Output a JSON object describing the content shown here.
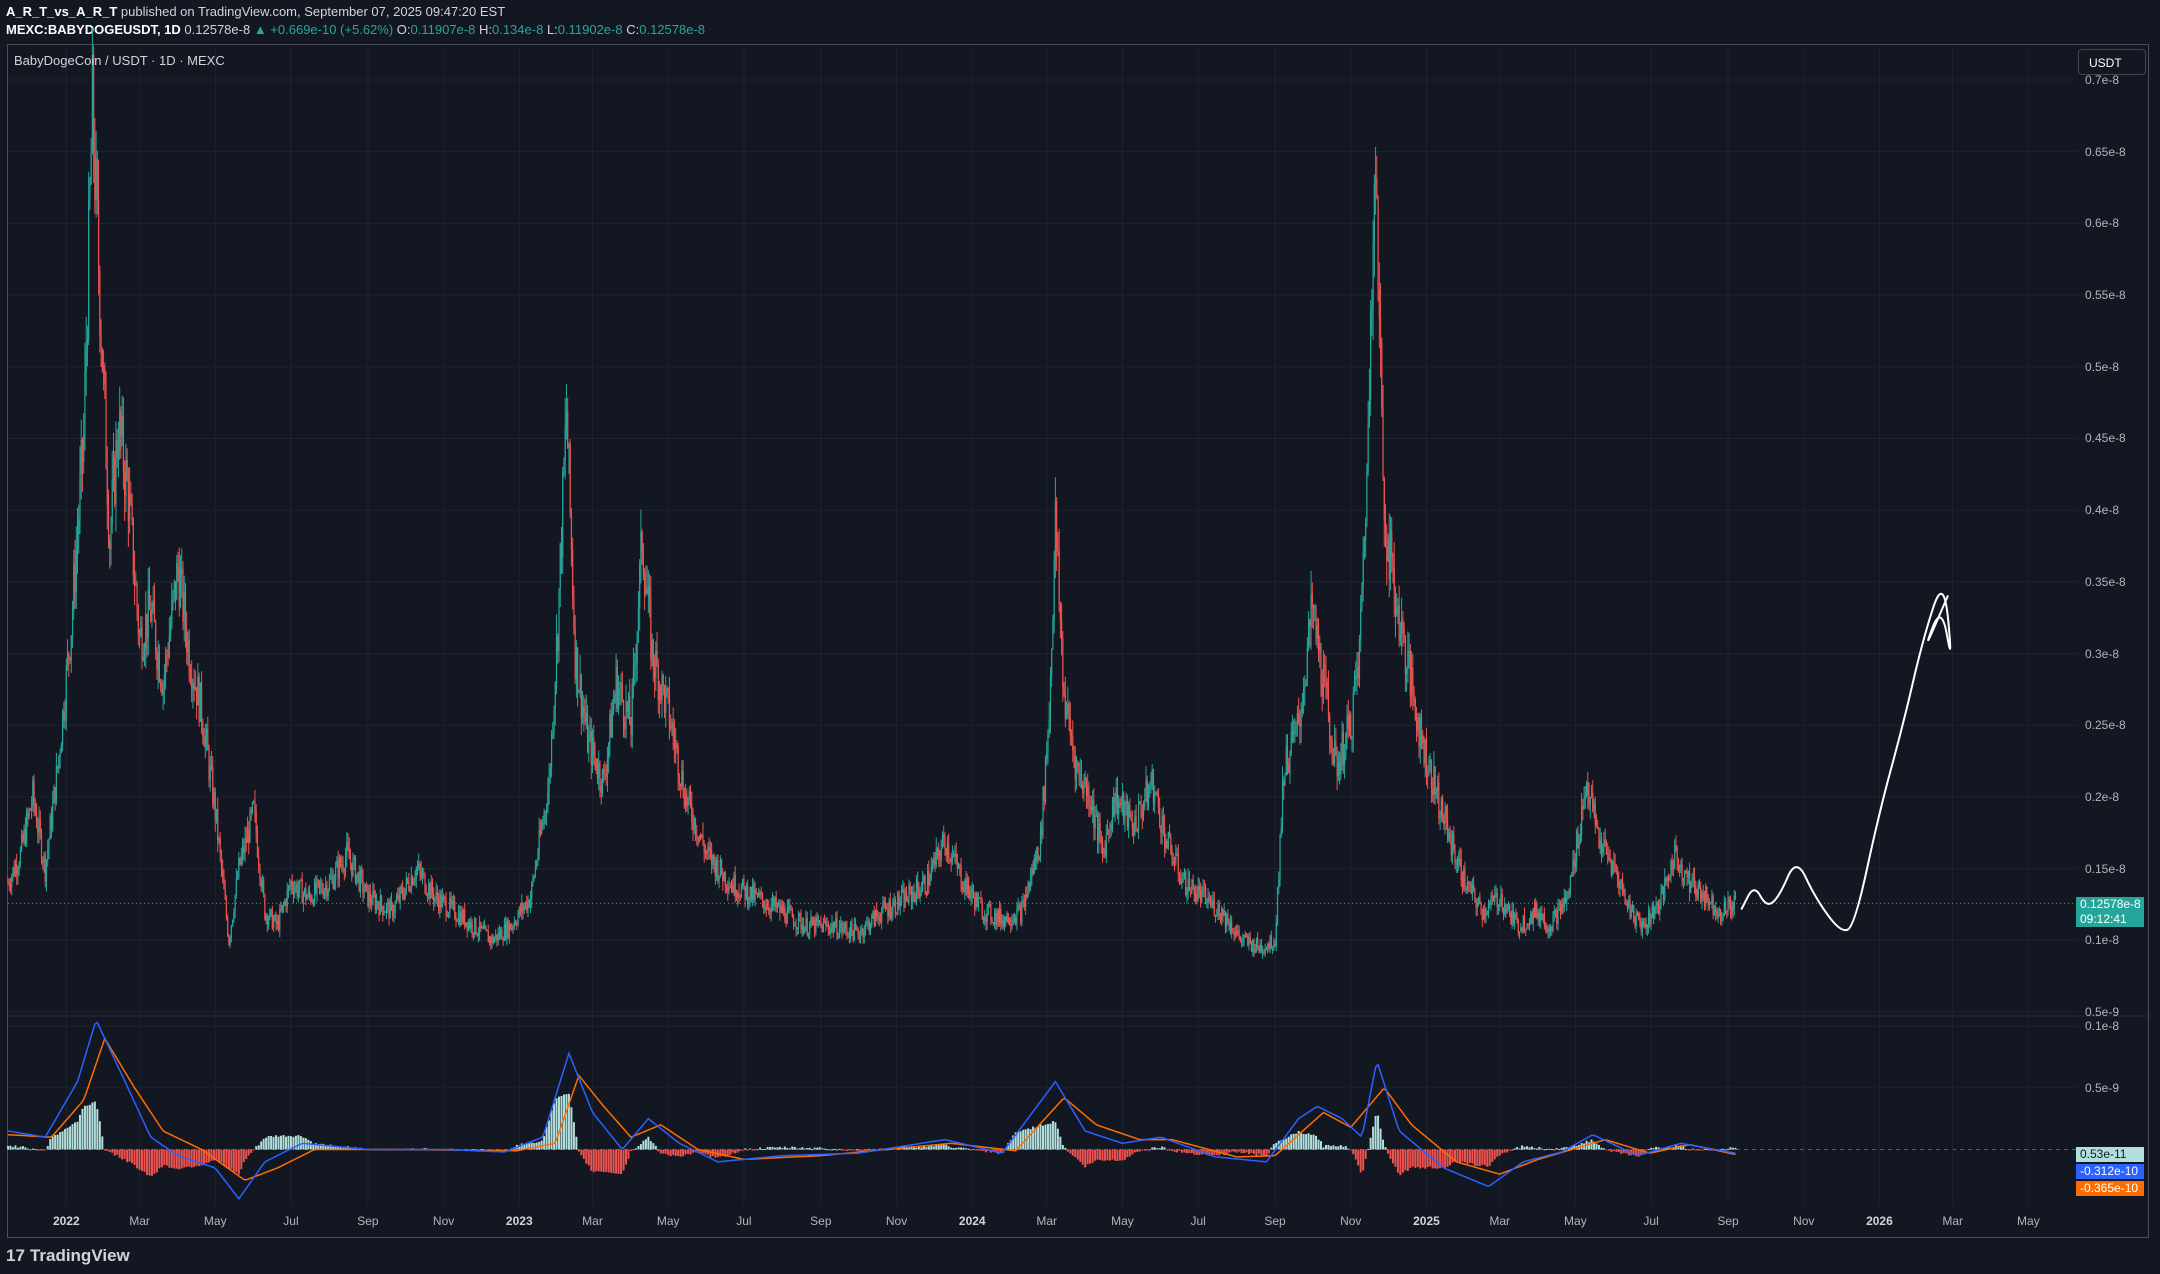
{
  "header": {
    "author": "A_R_T_vs_A_R_T",
    "published": "published on TradingView.com, September 07, 2025 09:47:20 EST",
    "symbol": "MEXC:BABYDOGEUSDT, 1D",
    "last": "0.12578e-8",
    "change": "▲ +0.669e-10 (+5.62%)",
    "o_label": "O:",
    "o_value": "0.11907e-8",
    "h_label": "H:",
    "h_value": "0.134e-8",
    "l_label": "L:",
    "l_value": "0.11902e-8",
    "c_label": "C:",
    "c_value": "0.12578e-8"
  },
  "legend": "BabyDogeCoin / USDT · 1D · MEXC",
  "currency_button": "USDT",
  "price_tag": {
    "price": "0.12578e-8",
    "countdown": "09:12:41"
  },
  "indicator_tags": {
    "histogram": "0.53e-11",
    "macd": "-0.312e-10",
    "signal": "-0.365e-10"
  },
  "footer": {
    "brand": "TradingView",
    "logo_mark": "17"
  },
  "colors": {
    "background": "#131722",
    "up": "#26a69a",
    "down": "#ef5350",
    "macd": "#2962ff",
    "signal": "#ff6d00",
    "hist_pos": "#b2dfdb",
    "drawing": "#ffffff"
  },
  "chart_data": {
    "type": "candlestick",
    "title": "BabyDogeCoin / USDT · 1D · MEXC",
    "ylabel": "USDT",
    "y_tick_labels": [
      "0.7e-8",
      "0.65e-8",
      "0.6e-8",
      "0.55e-8",
      "0.5e-8",
      "0.45e-8",
      "0.4e-8",
      "0.35e-8",
      "0.3e-8",
      "0.25e-8",
      "0.2e-8",
      "0.15e-8",
      "0.1e-8",
      "0.5e-9"
    ],
    "y_ticks": [
      0.7,
      0.65,
      0.6,
      0.55,
      0.5,
      0.45,
      0.4,
      0.35,
      0.3,
      0.25,
      0.2,
      0.15,
      0.1,
      0.05
    ],
    "y_unit_note": "values in units of 1e-8 USDT",
    "ylim": [
      0.05,
      0.7
    ],
    "x_tick_labels": [
      {
        "label": "2022",
        "date": "2022-01-01",
        "year": true
      },
      {
        "label": "Mar",
        "date": "2022-03-01"
      },
      {
        "label": "May",
        "date": "2022-05-01"
      },
      {
        "label": "Jul",
        "date": "2022-07-01"
      },
      {
        "label": "Sep",
        "date": "2022-09-01"
      },
      {
        "label": "Nov",
        "date": "2022-11-01"
      },
      {
        "label": "2023",
        "date": "2023-01-01",
        "year": true
      },
      {
        "label": "Mar",
        "date": "2023-03-01"
      },
      {
        "label": "May",
        "date": "2023-05-01"
      },
      {
        "label": "Jul",
        "date": "2023-07-01"
      },
      {
        "label": "Sep",
        "date": "2023-09-01"
      },
      {
        "label": "Nov",
        "date": "2023-11-01"
      },
      {
        "label": "2024",
        "date": "2024-01-01",
        "year": true
      },
      {
        "label": "Mar",
        "date": "2024-03-01"
      },
      {
        "label": "May",
        "date": "2024-05-01"
      },
      {
        "label": "Jul",
        "date": "2024-07-01"
      },
      {
        "label": "Sep",
        "date": "2024-09-01"
      },
      {
        "label": "Nov",
        "date": "2024-11-01"
      },
      {
        "label": "2025",
        "date": "2025-01-01",
        "year": true
      },
      {
        "label": "Mar",
        "date": "2025-03-01"
      },
      {
        "label": "May",
        "date": "2025-05-01"
      },
      {
        "label": "Jul",
        "date": "2025-07-01"
      },
      {
        "label": "Sep",
        "date": "2025-09-01"
      },
      {
        "label": "Nov",
        "date": "2025-11-01"
      },
      {
        "label": "2026",
        "date": "2026-01-01",
        "year": true
      },
      {
        "label": "Mar",
        "date": "2026-03-01"
      },
      {
        "label": "May",
        "date": "2026-05-01"
      }
    ],
    "x_range": [
      "2021-11-15",
      "2026-06-10"
    ],
    "price_path": [
      [
        "2021-11-15",
        0.14
      ],
      [
        "2021-11-25",
        0.16
      ],
      [
        "2021-12-05",
        0.2
      ],
      [
        "2021-12-15",
        0.15
      ],
      [
        "2021-12-25",
        0.22
      ],
      [
        "2022-01-05",
        0.32
      ],
      [
        "2022-01-15",
        0.45
      ],
      [
        "2022-01-22",
        0.68
      ],
      [
        "2022-01-28",
        0.55
      ],
      [
        "2022-02-05",
        0.38
      ],
      [
        "2022-02-12",
        0.46
      ],
      [
        "2022-02-20",
        0.41
      ],
      [
        "2022-03-01",
        0.31
      ],
      [
        "2022-03-10",
        0.33
      ],
      [
        "2022-03-20",
        0.28
      ],
      [
        "2022-04-01",
        0.36
      ],
      [
        "2022-04-10",
        0.3
      ],
      [
        "2022-04-20",
        0.26
      ],
      [
        "2022-05-01",
        0.19
      ],
      [
        "2022-05-12",
        0.1
      ],
      [
        "2022-05-20",
        0.15
      ],
      [
        "2022-06-01",
        0.19
      ],
      [
        "2022-06-10",
        0.12
      ],
      [
        "2022-06-20",
        0.11
      ],
      [
        "2022-07-01",
        0.14
      ],
      [
        "2022-07-15",
        0.13
      ],
      [
        "2022-08-01",
        0.14
      ],
      [
        "2022-08-15",
        0.16
      ],
      [
        "2022-09-01",
        0.13
      ],
      [
        "2022-09-20",
        0.12
      ],
      [
        "2022-10-10",
        0.15
      ],
      [
        "2022-10-25",
        0.13
      ],
      [
        "2022-11-10",
        0.12
      ],
      [
        "2022-11-25",
        0.11
      ],
      [
        "2022-12-10",
        0.1
      ],
      [
        "2022-12-25",
        0.11
      ],
      [
        "2023-01-10",
        0.13
      ],
      [
        "2023-01-25",
        0.21
      ],
      [
        "2023-02-01",
        0.32
      ],
      [
        "2023-02-08",
        0.47
      ],
      [
        "2023-02-15",
        0.3
      ],
      [
        "2023-02-25",
        0.24
      ],
      [
        "2023-03-10",
        0.21
      ],
      [
        "2023-03-20",
        0.28
      ],
      [
        "2023-04-01",
        0.25
      ],
      [
        "2023-04-10",
        0.38
      ],
      [
        "2023-04-18",
        0.3
      ],
      [
        "2023-05-01",
        0.26
      ],
      [
        "2023-05-15",
        0.2
      ],
      [
        "2023-06-01",
        0.16
      ],
      [
        "2023-06-20",
        0.14
      ],
      [
        "2023-07-10",
        0.13
      ],
      [
        "2023-08-01",
        0.12
      ],
      [
        "2023-08-20",
        0.11
      ],
      [
        "2023-09-10",
        0.11
      ],
      [
        "2023-10-01",
        0.105
      ],
      [
        "2023-10-20",
        0.12
      ],
      [
        "2023-11-10",
        0.13
      ],
      [
        "2023-11-25",
        0.14
      ],
      [
        "2023-12-10",
        0.17
      ],
      [
        "2023-12-25",
        0.14
      ],
      [
        "2024-01-10",
        0.12
      ],
      [
        "2024-01-25",
        0.115
      ],
      [
        "2024-02-10",
        0.12
      ],
      [
        "2024-02-25",
        0.17
      ],
      [
        "2024-03-03",
        0.26
      ],
      [
        "2024-03-08",
        0.39
      ],
      [
        "2024-03-15",
        0.27
      ],
      [
        "2024-03-25",
        0.22
      ],
      [
        "2024-04-05",
        0.2
      ],
      [
        "2024-04-15",
        0.16
      ],
      [
        "2024-04-25",
        0.2
      ],
      [
        "2024-05-10",
        0.18
      ],
      [
        "2024-05-25",
        0.21
      ],
      [
        "2024-06-05",
        0.17
      ],
      [
        "2024-06-20",
        0.14
      ],
      [
        "2024-07-05",
        0.13
      ],
      [
        "2024-07-20",
        0.12
      ],
      [
        "2024-08-05",
        0.1
      ],
      [
        "2024-08-20",
        0.095
      ],
      [
        "2024-09-01",
        0.1
      ],
      [
        "2024-09-08",
        0.22
      ],
      [
        "2024-09-20",
        0.25
      ],
      [
        "2024-10-01",
        0.33
      ],
      [
        "2024-10-10",
        0.28
      ],
      [
        "2024-10-20",
        0.22
      ],
      [
        "2024-11-01",
        0.25
      ],
      [
        "2024-11-08",
        0.3
      ],
      [
        "2024-11-15",
        0.45
      ],
      [
        "2024-11-20",
        0.66
      ],
      [
        "2024-11-28",
        0.4
      ],
      [
        "2024-12-05",
        0.35
      ],
      [
        "2024-12-15",
        0.3
      ],
      [
        "2024-12-28",
        0.24
      ],
      [
        "2025-01-10",
        0.2
      ],
      [
        "2025-01-20",
        0.17
      ],
      [
        "2025-02-01",
        0.14
      ],
      [
        "2025-02-15",
        0.12
      ],
      [
        "2025-03-01",
        0.13
      ],
      [
        "2025-03-15",
        0.11
      ],
      [
        "2025-04-01",
        0.12
      ],
      [
        "2025-04-10",
        0.11
      ],
      [
        "2025-04-25",
        0.13
      ],
      [
        "2025-05-10",
        0.21
      ],
      [
        "2025-05-20",
        0.17
      ],
      [
        "2025-06-01",
        0.15
      ],
      [
        "2025-06-15",
        0.12
      ],
      [
        "2025-06-25",
        0.11
      ],
      [
        "2025-07-10",
        0.13
      ],
      [
        "2025-07-20",
        0.16
      ],
      [
        "2025-08-01",
        0.14
      ],
      [
        "2025-08-15",
        0.13
      ],
      [
        "2025-08-25",
        0.12
      ],
      [
        "2025-09-07",
        0.126
      ]
    ],
    "drawing_path": [
      [
        "2025-09-12",
        0.122
      ],
      [
        "2025-09-22",
        0.139
      ],
      [
        "2025-10-02",
        0.123
      ],
      [
        "2025-10-12",
        0.13
      ],
      [
        "2025-10-26",
        0.158
      ],
      [
        "2025-11-10",
        0.13
      ],
      [
        "2025-12-01",
        0.105
      ],
      [
        "2025-12-12",
        0.11
      ],
      [
        "2026-01-01",
        0.19
      ],
      [
        "2026-01-20",
        0.25
      ],
      [
        "2026-02-05",
        0.31
      ],
      [
        "2026-02-22",
        0.355
      ],
      [
        "2026-03-01",
        0.29
      ],
      [
        "2026-02-20",
        0.335
      ],
      [
        "2026-02-05",
        0.3
      ],
      [
        "2026-02-25",
        0.34
      ]
    ],
    "last_price": 0.12578,
    "indicator": {
      "type": "macd",
      "y_tick_labels": [
        "0.1e-8",
        "0.5e-9"
      ],
      "y_ticks": [
        1.0,
        0.5
      ],
      "y_unit_note": "values in units of 1e-9 USDT",
      "ylim": [
        -0.45,
        1.05
      ],
      "macd_path": [
        [
          "2021-11-15",
          0.15
        ],
        [
          "2021-12-15",
          0.1
        ],
        [
          "2022-01-10",
          0.55
        ],
        [
          "2022-01-25",
          1.05
        ],
        [
          "2022-02-15",
          0.6
        ],
        [
          "2022-03-10",
          0.1
        ],
        [
          "2022-04-01",
          -0.05
        ],
        [
          "2022-05-01",
          -0.15
        ],
        [
          "2022-05-20",
          -0.4
        ],
        [
          "2022-06-10",
          -0.1
        ],
        [
          "2022-07-10",
          0.05
        ],
        [
          "2022-09-01",
          0.0
        ],
        [
          "2022-11-01",
          0.0
        ],
        [
          "2022-12-20",
          -0.02
        ],
        [
          "2023-01-20",
          0.1
        ],
        [
          "2023-02-10",
          0.78
        ],
        [
          "2023-03-01",
          0.3
        ],
        [
          "2023-03-25",
          0.0
        ],
        [
          "2023-04-15",
          0.25
        ],
        [
          "2023-05-10",
          0.05
        ],
        [
          "2023-06-10",
          -0.1
        ],
        [
          "2023-08-01",
          -0.05
        ],
        [
          "2023-10-01",
          -0.03
        ],
        [
          "2023-12-10",
          0.08
        ],
        [
          "2024-01-25",
          -0.03
        ],
        [
          "2024-03-08",
          0.55
        ],
        [
          "2024-04-01",
          0.15
        ],
        [
          "2024-05-01",
          0.05
        ],
        [
          "2024-06-01",
          0.1
        ],
        [
          "2024-07-15",
          -0.06
        ],
        [
          "2024-08-25",
          -0.1
        ],
        [
          "2024-09-20",
          0.25
        ],
        [
          "2024-10-05",
          0.35
        ],
        [
          "2024-10-25",
          0.25
        ],
        [
          "2024-11-10",
          0.1
        ],
        [
          "2024-11-22",
          0.72
        ],
        [
          "2024-12-10",
          0.15
        ],
        [
          "2025-01-15",
          -0.15
        ],
        [
          "2025-02-20",
          -0.3
        ],
        [
          "2025-03-20",
          -0.1
        ],
        [
          "2025-04-20",
          -0.02
        ],
        [
          "2025-05-15",
          0.12
        ],
        [
          "2025-06-20",
          -0.05
        ],
        [
          "2025-07-25",
          0.05
        ],
        [
          "2025-09-07",
          -0.03
        ]
      ],
      "signal_path": [
        [
          "2021-11-15",
          0.12
        ],
        [
          "2021-12-20",
          0.1
        ],
        [
          "2022-01-15",
          0.4
        ],
        [
          "2022-02-01",
          0.9
        ],
        [
          "2022-02-25",
          0.5
        ],
        [
          "2022-03-20",
          0.15
        ],
        [
          "2022-04-20",
          0.0
        ],
        [
          "2022-05-25",
          -0.25
        ],
        [
          "2022-06-20",
          -0.15
        ],
        [
          "2022-07-20",
          0.0
        ],
        [
          "2022-10-01",
          0.0
        ],
        [
          "2022-12-30",
          -0.01
        ],
        [
          "2023-01-30",
          0.05
        ],
        [
          "2023-02-18",
          0.6
        ],
        [
          "2023-03-10",
          0.35
        ],
        [
          "2023-04-01",
          0.1
        ],
        [
          "2023-04-25",
          0.2
        ],
        [
          "2023-05-25",
          0.0
        ],
        [
          "2023-07-01",
          -0.08
        ],
        [
          "2023-09-01",
          -0.05
        ],
        [
          "2023-12-15",
          0.05
        ],
        [
          "2024-02-05",
          -0.01
        ],
        [
          "2024-03-15",
          0.42
        ],
        [
          "2024-04-10",
          0.2
        ],
        [
          "2024-05-15",
          0.08
        ],
        [
          "2024-06-10",
          0.08
        ],
        [
          "2024-08-01",
          -0.06
        ],
        [
          "2024-09-01",
          -0.05
        ],
        [
          "2024-10-10",
          0.3
        ],
        [
          "2024-11-01",
          0.18
        ],
        [
          "2024-11-28",
          0.5
        ],
        [
          "2024-12-20",
          0.2
        ],
        [
          "2025-01-25",
          -0.1
        ],
        [
          "2025-03-01",
          -0.2
        ],
        [
          "2025-04-01",
          -0.08
        ],
        [
          "2025-05-25",
          0.08
        ],
        [
          "2025-06-30",
          -0.03
        ],
        [
          "2025-08-01",
          0.04
        ],
        [
          "2025-09-07",
          -0.04
        ]
      ]
    }
  }
}
